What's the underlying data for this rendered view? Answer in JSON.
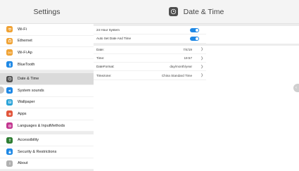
{
  "sidebar": {
    "title": "Settings",
    "groups": [
      [
        {
          "label": "Wi-Fi",
          "icon": "wifi-icon",
          "color": "#f0a233"
        },
        {
          "label": "Ethernet",
          "icon": "ethernet-icon",
          "color": "#f0a233"
        },
        {
          "label": "Wi-Fi Ap",
          "icon": "hotspot-icon",
          "color": "#f0a233"
        },
        {
          "label": "BlueTooth",
          "icon": "bluetooth-icon",
          "color": "#1e88e5"
        }
      ],
      [
        {
          "label": "Date & Time",
          "icon": "clock-icon",
          "color": "#4f4f4f",
          "active": true
        },
        {
          "label": "System sounds",
          "icon": "speaker-icon",
          "color": "#1e88e5"
        },
        {
          "label": "Wallpaper",
          "icon": "wallpaper-icon",
          "color": "#29a3d8"
        },
        {
          "label": "Apps",
          "icon": "apps-icon",
          "color": "#e2553b"
        },
        {
          "label": "Languages & InputMethods",
          "icon": "language-icon",
          "color": "#c2358f"
        }
      ],
      [
        {
          "label": "Accessibility",
          "icon": "accessibility-icon",
          "color": "#2e7d32"
        },
        {
          "label": "Security & Restrictions",
          "icon": "lock-icon",
          "color": "#1e88e5"
        },
        {
          "label": "About",
          "icon": "info-icon",
          "color": "#b0b0b0"
        }
      ]
    ]
  },
  "main": {
    "title": "Date & Time",
    "title_icon": "clock-icon",
    "toggles": [
      {
        "label": "24 Hour System",
        "on": true
      },
      {
        "label": "Auto Set Date And Time",
        "on": true
      }
    ],
    "fields": [
      {
        "label": "Date:",
        "value": "7/4/19"
      },
      {
        "label": "Time:",
        "value": "19:57"
      },
      {
        "label": "DateFormat:",
        "value": "day/month/year"
      },
      {
        "label": "Timezone:",
        "value": "China Standard Time"
      }
    ],
    "accent": "#1e88e5"
  }
}
